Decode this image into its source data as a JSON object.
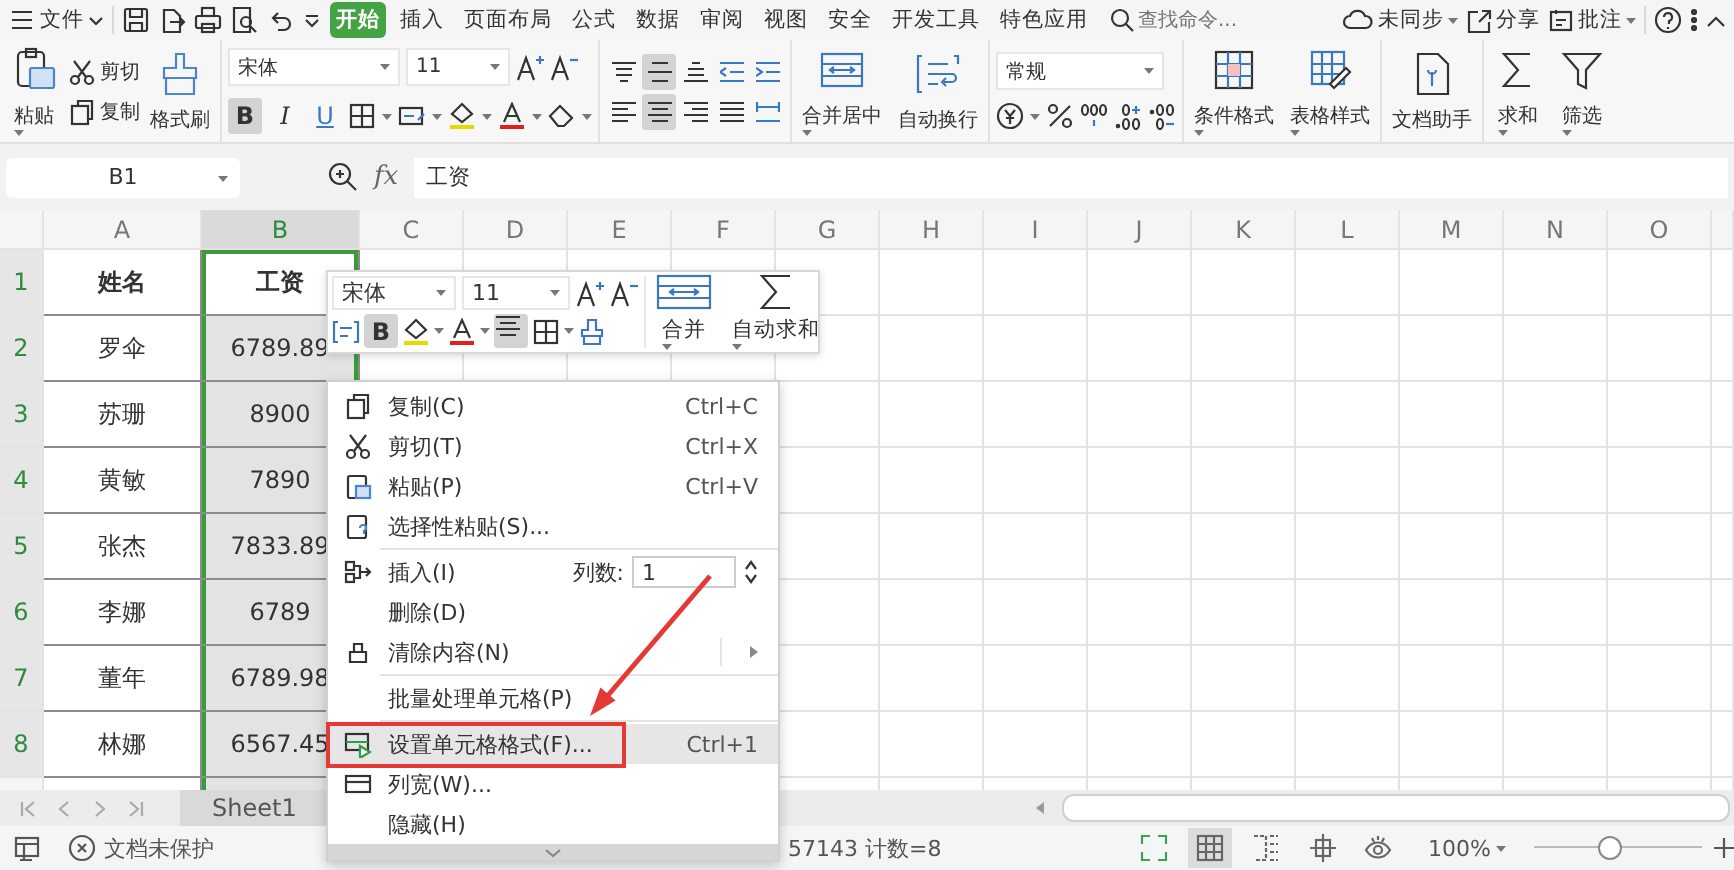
{
  "top_bar": {
    "file_menu": "文件",
    "tabs": [
      {
        "label": "开始",
        "selected": true
      },
      {
        "label": "插入",
        "selected": false
      },
      {
        "label": "页面布局",
        "selected": false
      },
      {
        "label": "公式",
        "selected": false
      },
      {
        "label": "数据",
        "selected": false
      },
      {
        "label": "审阅",
        "selected": false
      },
      {
        "label": "视图",
        "selected": false
      },
      {
        "label": "安全",
        "selected": false
      },
      {
        "label": "开发工具",
        "selected": false
      },
      {
        "label": "特色应用",
        "selected": false
      }
    ],
    "search": {
      "placeholder": "查找命令..."
    },
    "sync": "未同步",
    "share": "分享",
    "comment": "批注"
  },
  "ribbon": {
    "paste": "粘贴",
    "cut": "剪切",
    "copy": "复制",
    "format_painter": "格式刷",
    "font": "宋体",
    "font_size": "11",
    "format_buttons": [
      {
        "kind": "bold",
        "label": "B",
        "pressed": true
      },
      {
        "kind": "italic",
        "label": "I",
        "pressed": false
      },
      {
        "kind": "underline",
        "label": "U",
        "pressed": false
      }
    ],
    "align_buttons": [
      {
        "kind": "top",
        "selected": false
      },
      {
        "kind": "middle",
        "selected": true
      },
      {
        "kind": "bottom",
        "selected": false
      },
      {
        "kind": "outdent",
        "selected": false
      },
      {
        "kind": "indent",
        "selected": false
      },
      {
        "kind": "left",
        "selected": false
      },
      {
        "kind": "center",
        "selected": true
      },
      {
        "kind": "right",
        "selected": false
      },
      {
        "kind": "justify",
        "selected": false
      },
      {
        "kind": "distributed",
        "selected": false
      }
    ],
    "merge_center": "合并居中",
    "wrap_text": "自动换行",
    "number_format": "常规",
    "conditional_format": "条件格式",
    "table_style": "表格样式",
    "doc_assistant": "文档助手",
    "sum": "求和",
    "filter": "筛选"
  },
  "formula_bar": {
    "cell_ref": "B1",
    "function_label": "fx",
    "value": "工资"
  },
  "sheet": {
    "columns": [
      {
        "label": "A",
        "selected": false
      },
      {
        "label": "B",
        "selected": true
      },
      {
        "label": "C",
        "selected": false
      },
      {
        "label": "D",
        "selected": false
      },
      {
        "label": "E",
        "selected": false
      },
      {
        "label": "F",
        "selected": false
      },
      {
        "label": "G",
        "selected": false
      },
      {
        "label": "H",
        "selected": false
      },
      {
        "label": "I",
        "selected": false
      },
      {
        "label": "J",
        "selected": false
      },
      {
        "label": "K",
        "selected": false
      },
      {
        "label": "L",
        "selected": false
      },
      {
        "label": "M",
        "selected": false
      },
      {
        "label": "N",
        "selected": false
      },
      {
        "label": "O",
        "selected": false
      }
    ],
    "row_headers": [
      {
        "label": "1",
        "selected": true
      },
      {
        "label": "2",
        "selected": true
      },
      {
        "label": "3",
        "selected": true
      },
      {
        "label": "4",
        "selected": true
      },
      {
        "label": "5",
        "selected": true
      },
      {
        "label": "6",
        "selected": true
      },
      {
        "label": "7",
        "selected": true
      },
      {
        "label": "8",
        "selected": true
      }
    ],
    "rows": [
      [
        "姓名",
        "工资"
      ],
      [
        "罗伞",
        "6789.89"
      ],
      [
        "苏珊",
        "8900"
      ],
      [
        "黄敏",
        "7890"
      ],
      [
        "张杰",
        "7833.89"
      ],
      [
        "李娜",
        "6789"
      ],
      [
        "董年",
        "6789.98"
      ],
      [
        "林娜",
        "6567.45"
      ]
    ]
  },
  "mini_toolbar": {
    "font": "宋体",
    "font_size": "11",
    "bold_label": "B",
    "bold": true,
    "align_center": true,
    "merge": "合并",
    "autosum": "自动求和"
  },
  "context_menu": {
    "items": [
      {
        "kind": "copy",
        "label": "复制(C)",
        "shortcut": "Ctrl+C",
        "submenu": false,
        "selected": false,
        "divider_after": false
      },
      {
        "kind": "cut",
        "label": "剪切(T)",
        "shortcut": "Ctrl+X",
        "submenu": false,
        "selected": false,
        "divider_after": false
      },
      {
        "kind": "paste",
        "label": "粘贴(P)",
        "shortcut": "Ctrl+V",
        "submenu": false,
        "selected": false,
        "divider_after": false
      },
      {
        "kind": "paste_special",
        "label": "选择性粘贴(S)...",
        "submenu": false,
        "selected": false,
        "divider_after": true
      },
      {
        "kind": "insert",
        "label": "插入(I)",
        "count_label": "列数:",
        "count": "1",
        "submenu": false,
        "selected": false,
        "divider_after": false
      },
      {
        "kind": "plain",
        "label": "删除(D)",
        "submenu": false,
        "selected": false,
        "divider_after": false
      },
      {
        "kind": "clear",
        "label": "清除内容(N)",
        "submenu": true,
        "selected": false,
        "divider_after": true
      },
      {
        "kind": "plain",
        "label": "批量处理单元格(P)",
        "submenu": false,
        "selected": false,
        "divider_after": true
      },
      {
        "kind": "format",
        "label": "设置单元格格式(F)...",
        "shortcut": "Ctrl+1",
        "submenu": false,
        "selected": true,
        "divider_after": false
      },
      {
        "kind": "column_width",
        "label": "列宽(W)...",
        "submenu": false,
        "selected": false,
        "divider_after": false
      },
      {
        "kind": "plain",
        "label": "隐藏(H)",
        "submenu": false,
        "selected": false,
        "divider_after": false
      }
    ]
  },
  "sheet_tabs": [
    {
      "label": "Sheet1",
      "selected": true
    }
  ],
  "status_bar": {
    "protection": "文档未保护",
    "summary": "57143 计数=8",
    "view_buttons": [
      {
        "kind": "fullscreen",
        "selected": false
      },
      {
        "kind": "normal",
        "selected": true
      },
      {
        "kind": "page_break",
        "selected": false
      },
      {
        "kind": "reading",
        "selected": false
      },
      {
        "kind": "eye",
        "selected": false
      }
    ],
    "zoom": "100%",
    "zoom_slider": {
      "level": 0.45
    }
  }
}
